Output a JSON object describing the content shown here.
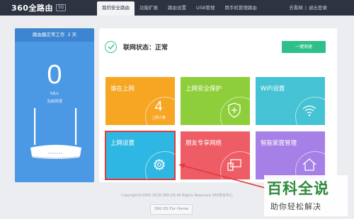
{
  "topbar": {
    "brand": "360全路由",
    "model": "5G",
    "nav": [
      "我的安全路由",
      "功能扩展",
      "路由设置",
      "USB管理",
      "用手机管理路由"
    ],
    "account": "去看网",
    "sep": "|",
    "logout": "退出登录"
  },
  "left_card": {
    "uptime_label": "路由器正常工作",
    "uptime_days": "2",
    "uptime_unit": "天",
    "speed_value": "0",
    "speed_unit": "KB/s",
    "speed_label": "当前网速"
  },
  "main": {
    "status_label": "联网状态：正常",
    "speed_test_button": "一键测速",
    "tiles": [
      {
        "label": "谁在上网",
        "count": "4",
        "count_label": "上网人数",
        "icon": "people-count-icon"
      },
      {
        "label": "上网安全保护",
        "icon": "shield-plus-icon"
      },
      {
        "label": "WiFi设置",
        "icon": "wifi-icon"
      },
      {
        "label": "上网设置",
        "icon": "gear-icon"
      },
      {
        "label": "朋友专享网络",
        "icon": "devices-icon"
      },
      {
        "label": "智能家居管理",
        "icon": "home-icon"
      }
    ]
  },
  "footer": {
    "copyright": "Copyright©2005-2018 360.CN All Rights Reserved 360安全中心",
    "os_button": "360 OS For Home"
  },
  "watermark": {
    "title": "百科全说",
    "subtitle": "助你轻松解决"
  },
  "colors": {
    "topbar": "#2d3340",
    "left_card": "#4b98e4",
    "tile_orange": "#f6a623",
    "tile_green": "#8fce3b",
    "tile_teal": "#45c3d4",
    "tile_blue": "#2fb7e4",
    "tile_red": "#ee5c66",
    "tile_purple": "#a680e6",
    "accent": "#2fbf8b",
    "highlight_arrow": "#e23a3a"
  }
}
